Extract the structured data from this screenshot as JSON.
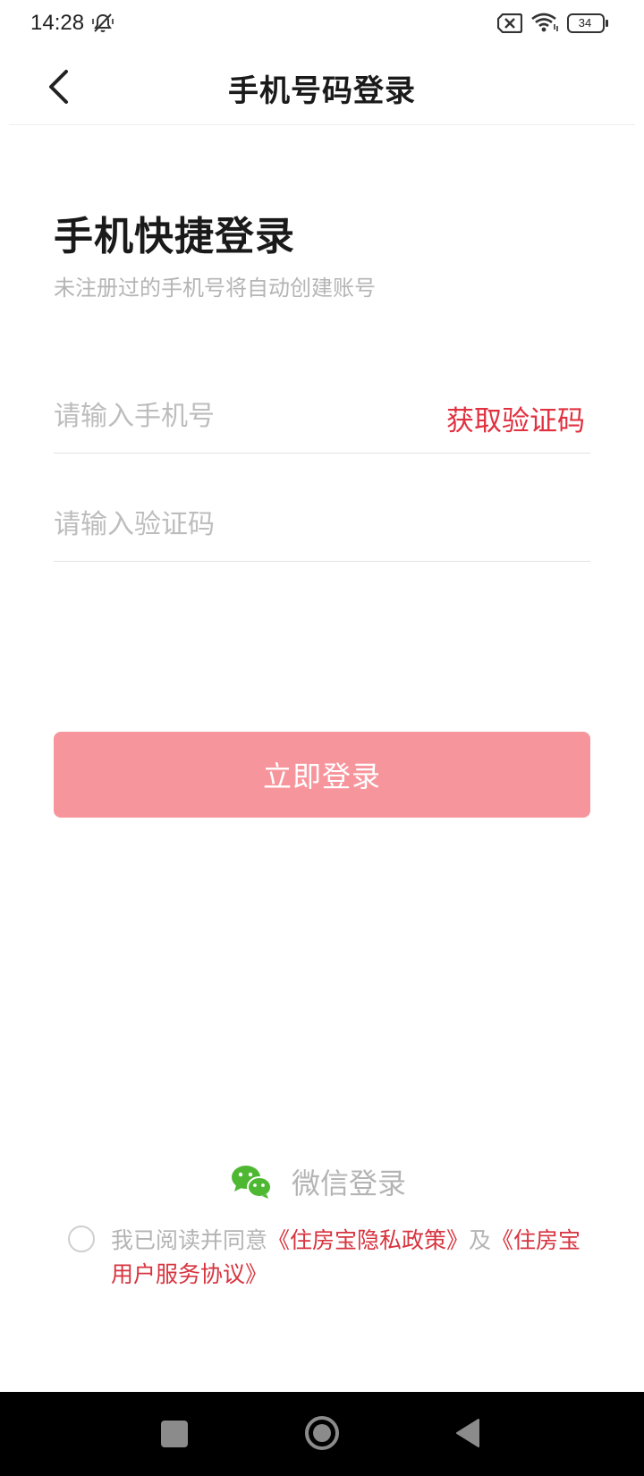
{
  "status_bar": {
    "time": "14:28",
    "battery": "34",
    "icons": [
      "mute-icon",
      "sim-blocked-icon",
      "wifi-icon",
      "battery-icon"
    ]
  },
  "header": {
    "title": "手机号码登录",
    "back_icon": "chevron-left-icon"
  },
  "main": {
    "heading": "手机快捷登录",
    "subheading": "未注册过的手机号将自动创建账号",
    "phone_input": {
      "placeholder": "请输入手机号",
      "value": ""
    },
    "get_code_label": "获取验证码",
    "code_input": {
      "placeholder": "请输入验证码",
      "value": ""
    },
    "login_button": "立即登录"
  },
  "wechat": {
    "label": "微信登录",
    "icon": "wechat-icon"
  },
  "agreement": {
    "prefix": "我已阅读并同意",
    "privacy_link": "《住房宝隐私政策》",
    "connector": "及",
    "service_link": "《住房宝用户服务协议》",
    "checked": false
  },
  "colors": {
    "accent_red": "#e1303f",
    "button_pink": "#f7959c",
    "wechat_green": "#4fb833",
    "placeholder_gray": "#bdbdbd"
  },
  "nav_bar": {
    "icons": [
      "recents-icon",
      "home-icon",
      "back-triangle-icon"
    ]
  }
}
